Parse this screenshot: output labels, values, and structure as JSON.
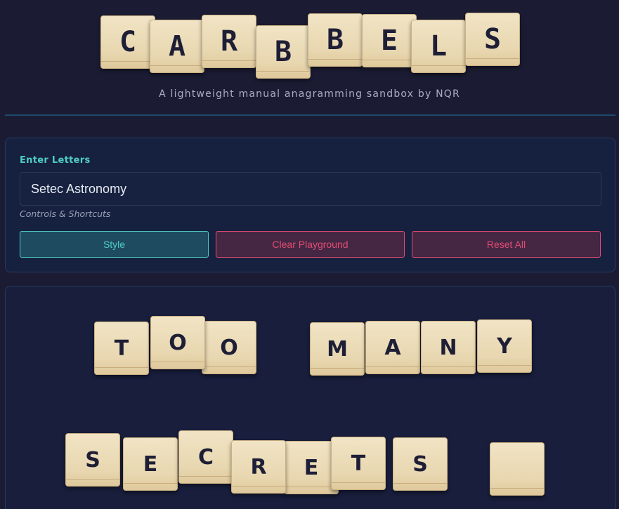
{
  "header": {
    "logo_tiles": [
      "C",
      "A",
      "R",
      "B",
      "B",
      "E",
      "L",
      "S"
    ],
    "subtitle": "A lightweight manual anagramming sandbox by NQR"
  },
  "controls": {
    "enter_label": "Enter Letters",
    "input_value": "Setec Astronomy",
    "controls_label": "Controls & Shortcuts",
    "style_button": "Style",
    "clear_button": "Clear Playground",
    "reset_button": "Reset All"
  },
  "playground": {
    "row1_tiles": [
      "T",
      "O",
      "O",
      "M",
      "A",
      "N",
      "Y"
    ],
    "row2_tiles": [
      "S",
      "E",
      "C",
      "R",
      "E",
      "T",
      "S",
      ""
    ]
  },
  "colors": {
    "background": "#1b1c33",
    "accent_teal": "#4ecdc4",
    "accent_pink": "#e14c72",
    "tile": "#ecdcb8"
  }
}
